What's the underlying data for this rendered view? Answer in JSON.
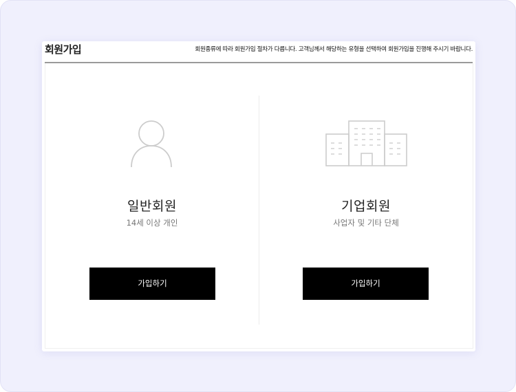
{
  "header": {
    "title": "회원가입",
    "description": "회원종류에 따라 회원가입 절차가 다릅니다. 고객님께서 해당하는 유형을 선택하여 회원가입을 진행해 주시기 바랍니다."
  },
  "options": [
    {
      "icon": "person-icon",
      "name": "일반회원",
      "subtitle": "14세 이상 개인",
      "button_label": "가입하기"
    },
    {
      "icon": "building-icon",
      "name": "기업회원",
      "subtitle": "사업자 및 기타 단체",
      "button_label": "가입하기"
    }
  ],
  "colors": {
    "page_background": "#f0f0fd",
    "card_background": "#ffffff",
    "button_background": "#000000",
    "button_text": "#ffffff",
    "icon_stroke": "#cccccc"
  }
}
